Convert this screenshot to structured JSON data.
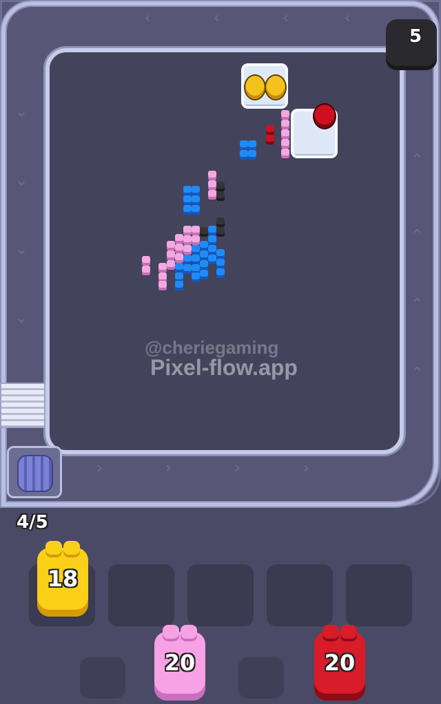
{
  "capacity_badge": {
    "value": "5"
  },
  "conveyor": {
    "counter": "4/5"
  },
  "watermark": {
    "handle": "@cheriegaming",
    "site": "Pixel-flow.app"
  },
  "shooters": [
    {
      "count": "18",
      "color": "yellow"
    },
    {
      "count": "20",
      "color": "pink"
    },
    {
      "count": "20",
      "color": "red"
    }
  ],
  "colors": {
    "pink": "#f4a8e0",
    "blue": "#1f8cf5",
    "dark": "#353538",
    "red": "#d01020",
    "yellow": "#fbd018"
  }
}
